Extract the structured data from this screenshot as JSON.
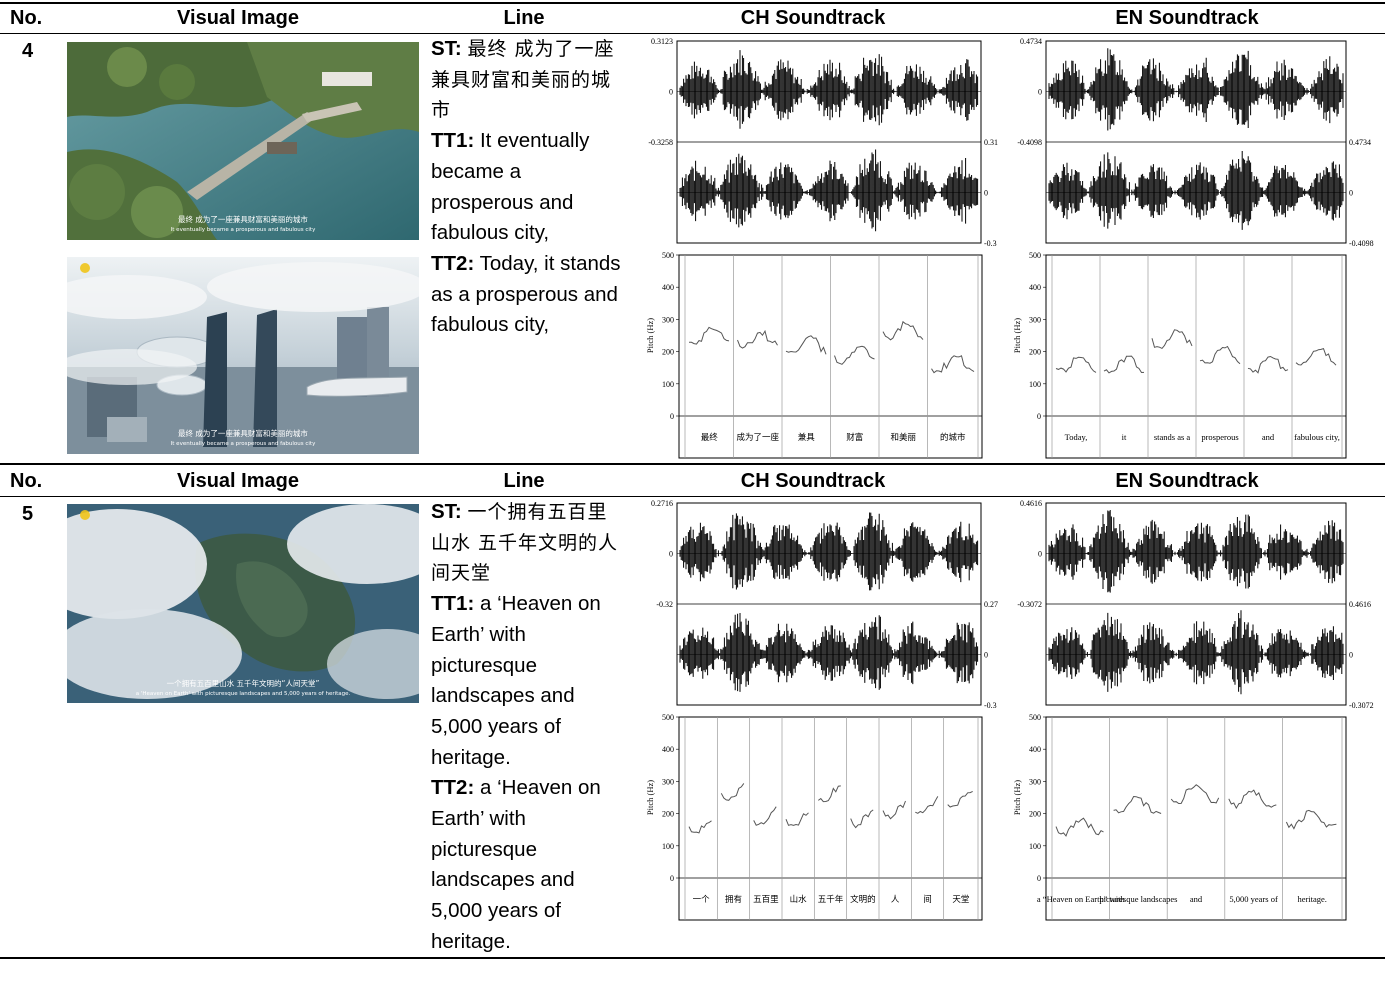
{
  "headers": {
    "no": "No.",
    "visual_image": "Visual Image",
    "line": "Line",
    "ch_soundtrack": "CH Soundtrack",
    "en_soundtrack": "EN Soundtrack"
  },
  "rows": [
    {
      "no": "4",
      "images": [
        {
          "subtitle_zh": "最终 成为了一座兼具财富和美丽的城市",
          "subtitle_en": "It eventually became a prosperous and fabulous city"
        },
        {
          "subtitle_zh": "最终 成为了一座兼具财富和美丽的城市",
          "subtitle_en": "It eventually became a prosperous and fabulous city"
        }
      ],
      "line": {
        "st_label": "ST:",
        "st_text": "最终 成为了一座兼具财富和美丽的城市",
        "tt1_label": "TT1:",
        "tt1_text": "It eventually became a prosperous and fabulous city,",
        "tt2_label": "TT2:",
        "tt2_text": "Today, it stands as a prosperous and fabulous city,"
      },
      "ch_wave": {
        "top_max": "0.3123",
        "top_zero": "0",
        "top_min": "-0.3258",
        "bottom_max": "0.31",
        "bottom_zero": "0",
        "bottom_min": "-0.3"
      },
      "en_wave": {
        "top_max": "0.4734",
        "top_zero": "0",
        "top_min": "-0.4098",
        "bottom_max": "0.4734",
        "bottom_zero": "0",
        "bottom_min": "-0.4098"
      },
      "ch_pitch": {
        "ylabel": "Pitch (Hz)",
        "yticks": [
          "500",
          "400",
          "300",
          "200",
          "100",
          "0"
        ],
        "segments": [
          "最终",
          "成为了一座",
          "兼具",
          "财富",
          "和美丽",
          "的城市"
        ]
      },
      "en_pitch": {
        "ylabel": "Pitch (Hz)",
        "yticks": [
          "500",
          "400",
          "300",
          "200",
          "100",
          "0"
        ],
        "segments": [
          "Today,",
          "it",
          "stands as a",
          "prosperous",
          "and",
          "fabulous city,"
        ]
      }
    },
    {
      "no": "5",
      "images": [
        {
          "subtitle_zh": "一个拥有五百里山水 五千年文明的“人间天堂”",
          "subtitle_en": "a 'Heaven on Earth' with picturesque landscapes and 5,000 years of heritage."
        }
      ],
      "line": {
        "st_label": "ST:",
        "st_text": "一个拥有五百里山水 五千年文明的人间天堂",
        "tt1_label": "TT1:",
        "tt1_text": "a ‘Heaven on Earth’ with picturesque landscapes and 5,000 years of heritage.",
        "tt2_label": "TT2:",
        "tt2_text": "a ‘Heaven on Earth’ with picturesque landscapes and 5,000 years of heritage."
      },
      "ch_wave": {
        "top_max": "0.2716",
        "top_zero": "0",
        "top_min": "-0.32",
        "bottom_max": "0.27",
        "bottom_zero": "0",
        "bottom_min": "-0.3"
      },
      "en_wave": {
        "top_max": "0.4616",
        "top_zero": "0",
        "top_min": "-0.3072",
        "bottom_max": "0.4616",
        "bottom_zero": "0",
        "bottom_min": "-0.3072"
      },
      "ch_pitch": {
        "ylabel": "Pitch (Hz)",
        "yticks": [
          "500",
          "400",
          "300",
          "200",
          "100",
          "0"
        ],
        "segments": [
          "一个",
          "拥有",
          "五百里",
          "山水",
          "五千年",
          "文明的",
          "人",
          "间",
          "天堂"
        ]
      },
      "en_pitch": {
        "ylabel": "Pitch (Hz)",
        "yticks": [
          "500",
          "400",
          "300",
          "200",
          "100",
          "0"
        ],
        "segments": [
          "a “Heaven on Earth” with",
          "picturesque landscapes",
          "and",
          "5,000 years of",
          "heritage."
        ]
      }
    }
  ],
  "colors": {
    "rule": "#000000",
    "water": "#3e7c86",
    "sky": "#c9d6de",
    "grid": "#9a9a9a"
  }
}
